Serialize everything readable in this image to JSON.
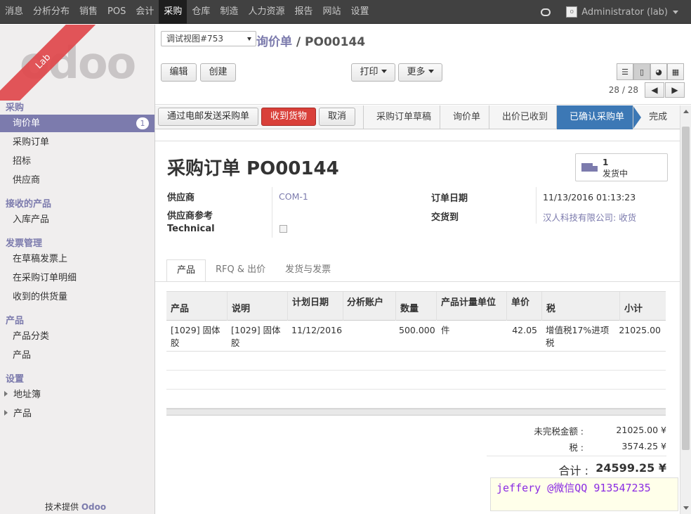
{
  "topnav": {
    "menus": [
      "消息",
      "分析分布",
      "销售",
      "POS",
      "会计",
      "采购",
      "仓库",
      "制造",
      "人力资源",
      "报告",
      "网站",
      "设置"
    ],
    "active_index": 5,
    "user": "Administrator (lab)"
  },
  "sidebar": {
    "logo_text": "odoo",
    "ribbon": "Lab",
    "sections": {
      "purchase": "采购",
      "received": "接收的产品",
      "invoice": "发票管理",
      "products": "产品",
      "settings": "设置"
    },
    "items": {
      "rfq": "询价单",
      "rfq_badge": "1",
      "po": "采购订单",
      "tender": "招标",
      "vendors": "供应商",
      "incoming": "入库产品",
      "draft_invoice": "在草稿发票上",
      "po_lines": "在采购订单明细",
      "received_qty": "收到的供货量",
      "product_category": "产品分类",
      "product": "产品",
      "address_book": "地址簿",
      "settings_product": "产品"
    },
    "powered_prefix": "技术提供",
    "powered_brand": "Odoo"
  },
  "control_panel": {
    "debug_view": "调试视图#753",
    "breadcrumb_parent": "询价单",
    "breadcrumb_sep": " / ",
    "breadcrumb_current": "PO00144",
    "edit_label": "编辑",
    "create_label": "创建",
    "print_label": "打印",
    "more_label": "更多",
    "pager": "28 / 28"
  },
  "statusbar": {
    "email_btn": "通过电邮发送采购单",
    "receive_btn": "收到货物",
    "cancel_btn": "取消",
    "stages": [
      "采购订单草稿",
      "询价单",
      "出价已收到",
      "已确认采购单",
      "完成"
    ],
    "current_stage_index": 3
  },
  "form": {
    "title": "采购订单 PO00144",
    "smart_button": {
      "count": "1",
      "label": "发货中"
    },
    "fields": {
      "vendor_label": "供应商",
      "vendor_value": "COM-1",
      "vendor_ref_label": "供应商参考",
      "technical_label": "Technical",
      "order_date_label": "订单日期",
      "order_date_value": "11/13/2016 01:13:23",
      "deliver_to_label": "交货到",
      "deliver_to_value": "汉人科技有限公司: 收货"
    },
    "tabs": [
      "产品",
      "RFQ & 出价",
      "发货与发票"
    ],
    "table": {
      "headers": [
        "产品",
        "说明",
        "计划日期",
        "分析账户",
        "数量",
        "产品计量单位",
        "单价",
        "税",
        "小计"
      ],
      "rows": [
        {
          "product": "[1029] 固体胶",
          "description": "[1029] 固体胶",
          "date": "11/12/2016",
          "account": "",
          "qty": "500.000",
          "uom": "件",
          "price": "42.05",
          "tax": "增值税17%进项税",
          "subtotal": "21025.00"
        }
      ]
    },
    "totals": {
      "untaxed_label": "未完税金额 :",
      "untaxed_value": "21025.00 ¥",
      "tax_label": "税 :",
      "tax_value": "3574.25 ¥",
      "total_label": "合计 :",
      "total_value": "24599.25 ¥"
    }
  },
  "watermark": "jeffery @微信QQ 913547235"
}
